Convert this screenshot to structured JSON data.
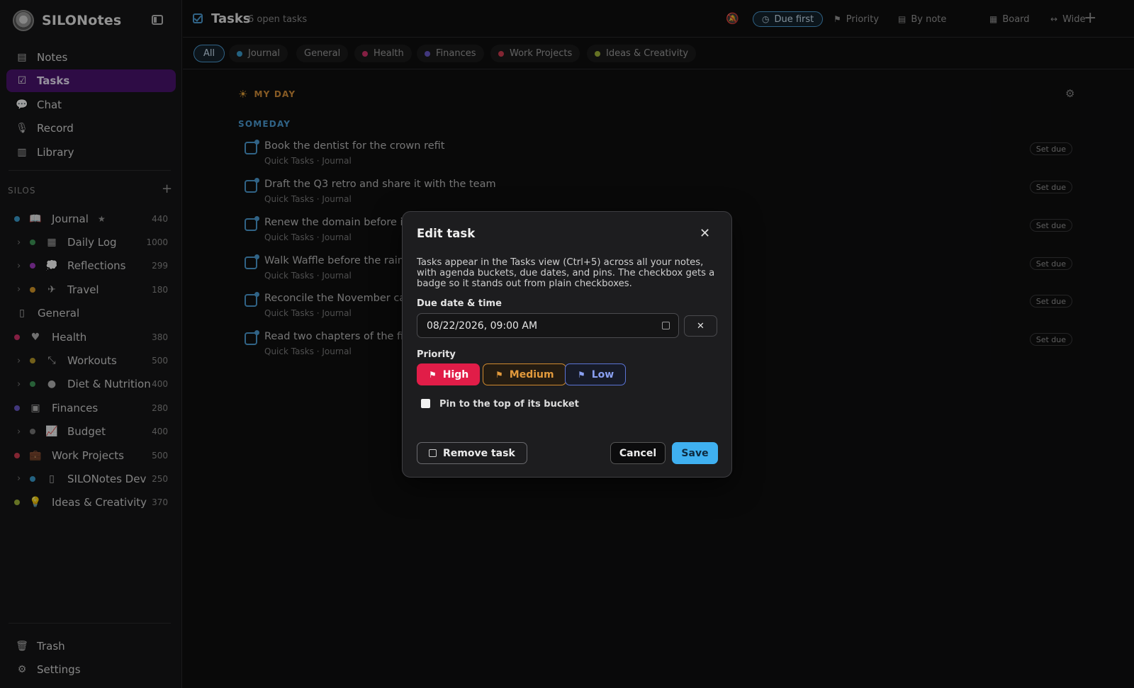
{
  "app": {
    "name": "SILONotes"
  },
  "nav": [
    {
      "label": "Notes",
      "icon": "document-icon",
      "glyph": "▤",
      "active": false
    },
    {
      "label": "Tasks",
      "icon": "checkbox-icon",
      "glyph": "☑",
      "active": true
    },
    {
      "label": "Chat",
      "icon": "chat-bubble-icon",
      "glyph": "💬",
      "active": false
    },
    {
      "label": "Record",
      "icon": "microphone-icon",
      "glyph": "🎙",
      "active": false
    },
    {
      "label": "Library",
      "icon": "library-icon",
      "glyph": "▥",
      "active": false
    }
  ],
  "silos_label": "SILOS",
  "silos": [
    {
      "name": "Journal",
      "count": "440",
      "dot": "#3b9ed1",
      "icon": "journal-icon",
      "glyph": "📖",
      "level": 0,
      "star": true
    },
    {
      "name": "Daily Log",
      "count": "1000",
      "dot": "#3f9a5a",
      "icon": "calendar-icon",
      "glyph": "▦",
      "level": 1,
      "star": false
    },
    {
      "name": "Reflections",
      "count": "299",
      "dot": "#a33cc4",
      "icon": "thought-bubble-icon",
      "glyph": "💭",
      "level": 1,
      "star": false
    },
    {
      "name": "Travel",
      "count": "180",
      "dot": "#d89a2a",
      "icon": "airplane-icon",
      "glyph": "✈",
      "level": 1,
      "star": false
    },
    {
      "name": "General",
      "count": "",
      "dot": "",
      "icon": "notebook-icon",
      "glyph": "▯",
      "level": -1,
      "star": false
    },
    {
      "name": "Health",
      "count": "380",
      "dot": "#d6336c",
      "icon": "heartbeat-icon",
      "glyph": "♥",
      "level": 0,
      "star": false
    },
    {
      "name": "Workouts",
      "count": "500",
      "dot": "#b89a2a",
      "icon": "dumbbell-icon",
      "glyph": "⤡",
      "level": 1,
      "star": false
    },
    {
      "name": "Diet & Nutrition",
      "count": "400",
      "dot": "#3f9a5a",
      "icon": "apple-icon",
      "glyph": "●",
      "level": 1,
      "star": false
    },
    {
      "name": "Finances",
      "count": "280",
      "dot": "#6a5ac9",
      "icon": "banknote-icon",
      "glyph": "▣",
      "level": 0,
      "star": false
    },
    {
      "name": "Budget",
      "count": "400",
      "dot": "#7a7a7a",
      "icon": "line-chart-icon",
      "glyph": "📈",
      "level": 1,
      "star": false
    },
    {
      "name": "Work Projects",
      "count": "500",
      "dot": "#d23c52",
      "icon": "briefcase-icon",
      "glyph": "💼",
      "level": 0,
      "star": false
    },
    {
      "name": "SILONotes Dev",
      "count": "250",
      "dot": "#3b9ed1",
      "icon": "phone-icon",
      "glyph": "▯",
      "level": 1,
      "star": false
    },
    {
      "name": "Ideas & Creativity",
      "count": "370",
      "dot": "#a3b83a",
      "icon": "lightbulb-icon",
      "glyph": "💡",
      "level": 0,
      "star": false
    }
  ],
  "bottom_nav": [
    {
      "label": "Trash",
      "icon": "trash-icon",
      "glyph": "🗑"
    },
    {
      "label": "Settings",
      "icon": "gear-icon",
      "glyph": "⚙"
    }
  ],
  "topbar": {
    "title": "Tasks",
    "subtitle": "6 open tasks",
    "sort_due": "Due first",
    "sort_priority": "Priority",
    "group_note": "By note",
    "view_board": "Board",
    "view_wide": "Wide"
  },
  "filters": [
    {
      "label": "All",
      "dot": "",
      "active": true
    },
    {
      "label": "Journal",
      "dot": "#3b9ed1",
      "active": false
    },
    {
      "label": "General",
      "dot": "",
      "active": false
    },
    {
      "label": "Health",
      "dot": "#d6336c",
      "active": false
    },
    {
      "label": "Finances",
      "dot": "#6a5ac9",
      "active": false
    },
    {
      "label": "Work Projects",
      "dot": "#d23c52",
      "active": false
    },
    {
      "label": "Ideas & Creativity",
      "dot": "#a3b83a",
      "active": false
    }
  ],
  "buckets": {
    "my_day": "MY DAY",
    "someday": "SOMEDAY"
  },
  "tasks": [
    {
      "title": "Book the dentist for the crown refit",
      "source": "Quick Tasks · Journal",
      "due_label": "Set due"
    },
    {
      "title": "Draft the Q3 retro and share it with the team",
      "source": "Quick Tasks · Journal",
      "due_label": "Set due"
    },
    {
      "title": "Renew the domain before it l",
      "source": "Quick Tasks · Journal",
      "due_label": "Set due"
    },
    {
      "title": "Walk Waffle before the rain c",
      "source": "Quick Tasks · Journal",
      "due_label": "Set due"
    },
    {
      "title": "Reconcile the November card",
      "source": "Quick Tasks · Journal",
      "due_label": "Set due"
    },
    {
      "title": "Read two chapters of the fiel",
      "source": "Quick Tasks · Journal",
      "due_label": "Set due"
    }
  ],
  "modal": {
    "title": "Edit task",
    "description": "Tasks appear in the Tasks view (Ctrl+5) across all your notes, with agenda buckets, due dates, and pins. The checkbox gets a badge so it stands out from plain checkboxes.",
    "due_label": "Due date & time",
    "due_value": "08/22/2026, 09:00 AM",
    "priority_label": "Priority",
    "priority_high": "High",
    "priority_medium": "Medium",
    "priority_low": "Low",
    "pin_label": "Pin to the top of its bucket",
    "remove_label": "Remove task",
    "cancel_label": "Cancel",
    "save_label": "Save"
  },
  "colors": {
    "accent": "#4ea0d8",
    "active_nav": "#4b1470",
    "high": "#e11d48",
    "medium": "#d08a2e",
    "low": "#5b74d6",
    "save": "#3fb0f0"
  }
}
